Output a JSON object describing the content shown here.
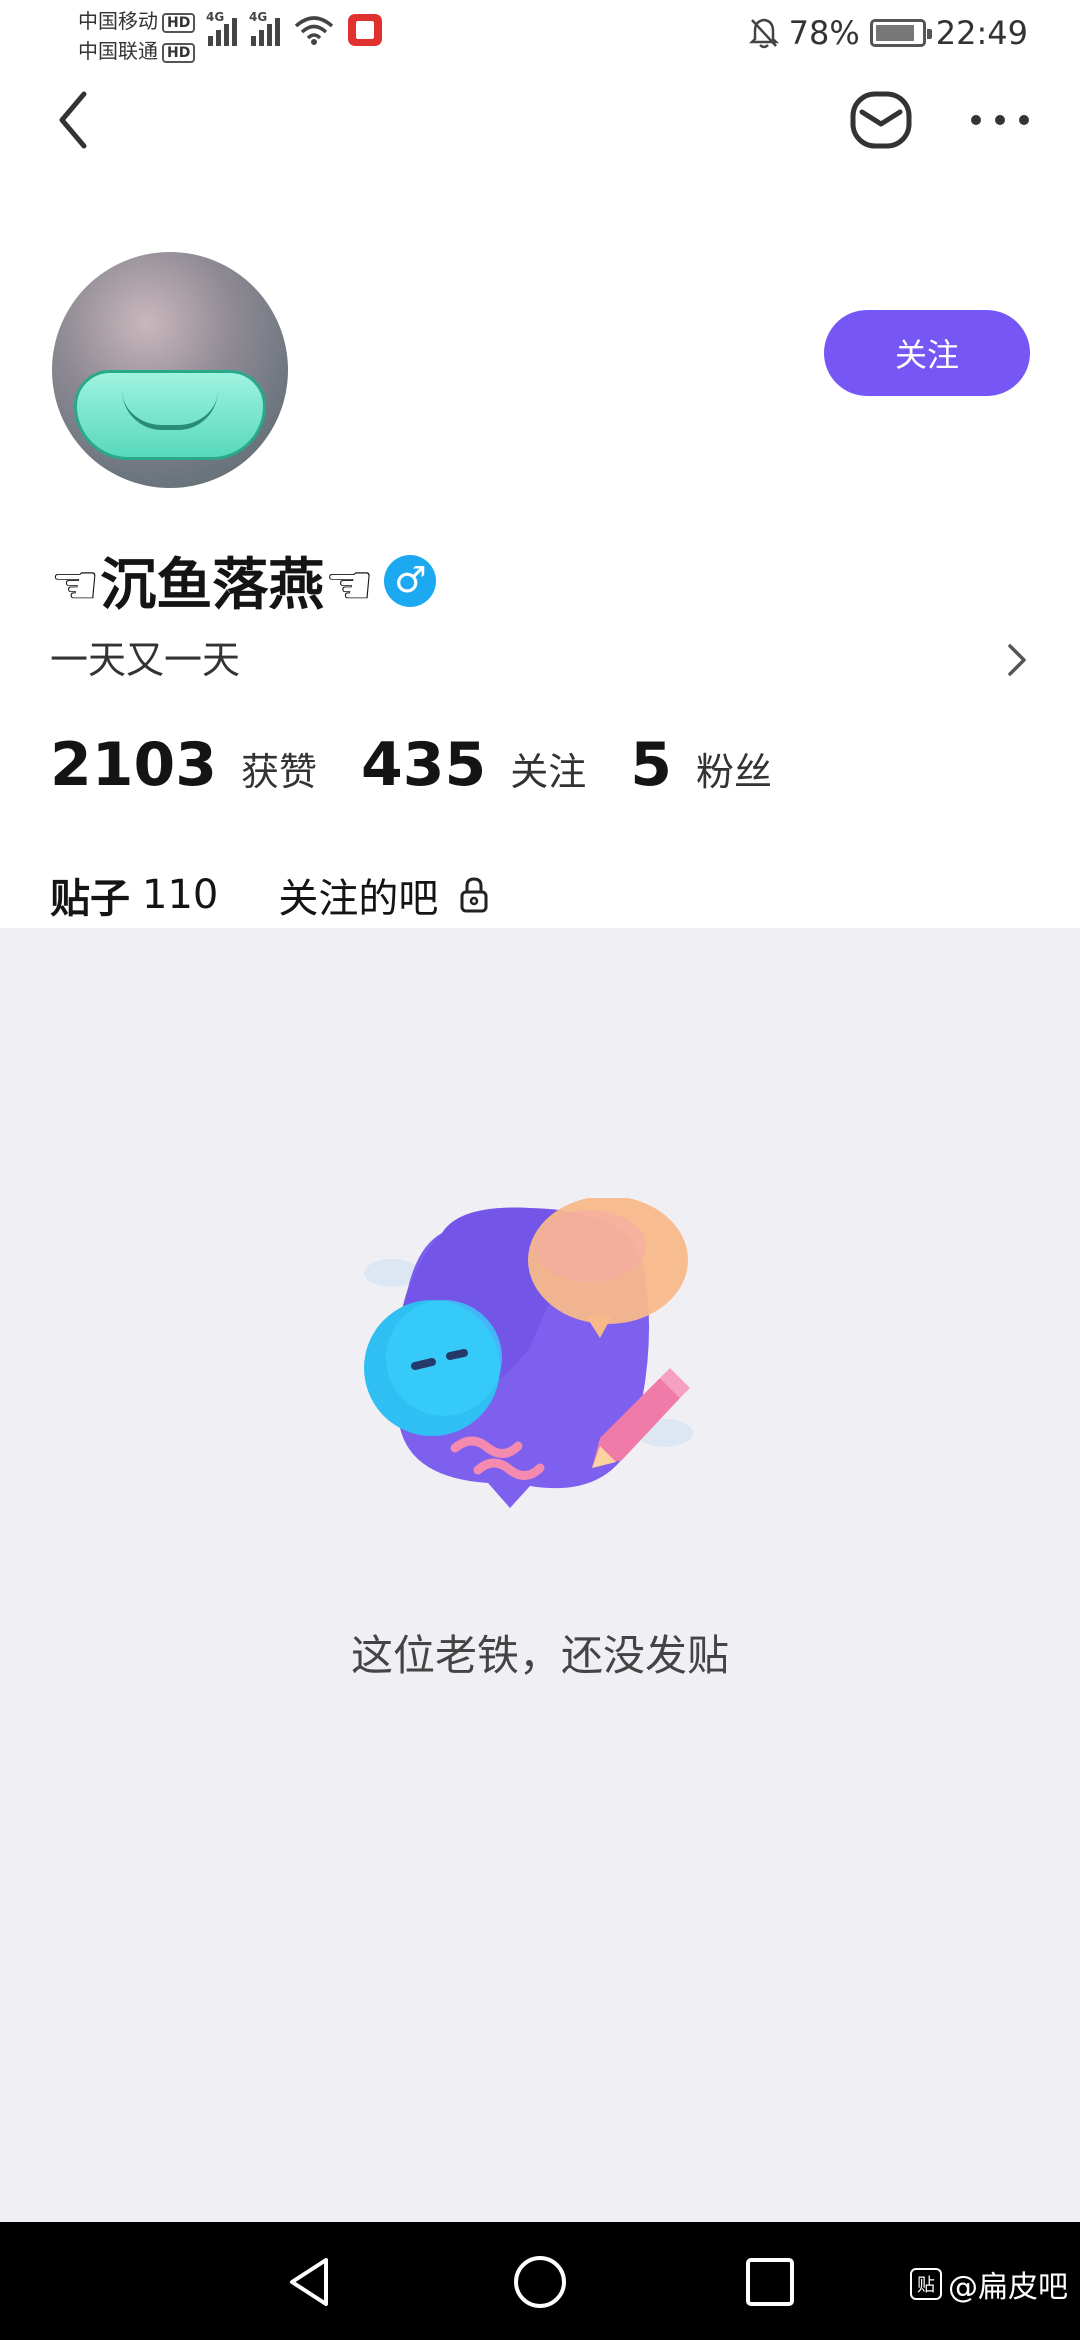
{
  "status_bar": {
    "carrier1": "中国移动",
    "carrier2": "中国联通",
    "hd": "HD",
    "network": "4G",
    "battery_percent": "78%",
    "time": "22:49"
  },
  "header": {
    "back_icon": "chevron-left-icon",
    "message_icon": "mail-icon",
    "more_icon": "more-horizontal-icon"
  },
  "profile": {
    "follow_label": "关注",
    "username": "☜沉鱼落燕☜",
    "gender_symbol": "♂",
    "bio": "一天又一天",
    "stats": [
      {
        "value": "2103",
        "label": "获赞"
      },
      {
        "value": "435",
        "label": "关注"
      },
      {
        "value": "5",
        "label": "粉丝"
      }
    ]
  },
  "tabs": [
    {
      "label": "贴子",
      "count": "110"
    },
    {
      "label": "关注的吧"
    }
  ],
  "empty_state": {
    "message": "这位老铁，还没发贴"
  },
  "watermark": {
    "icon_text": "贴",
    "text": "@扁皮吧"
  },
  "colors": {
    "accent": "#7657f5",
    "gender_blue": "#1da8f2",
    "content_bg": "#f0f0f4"
  }
}
